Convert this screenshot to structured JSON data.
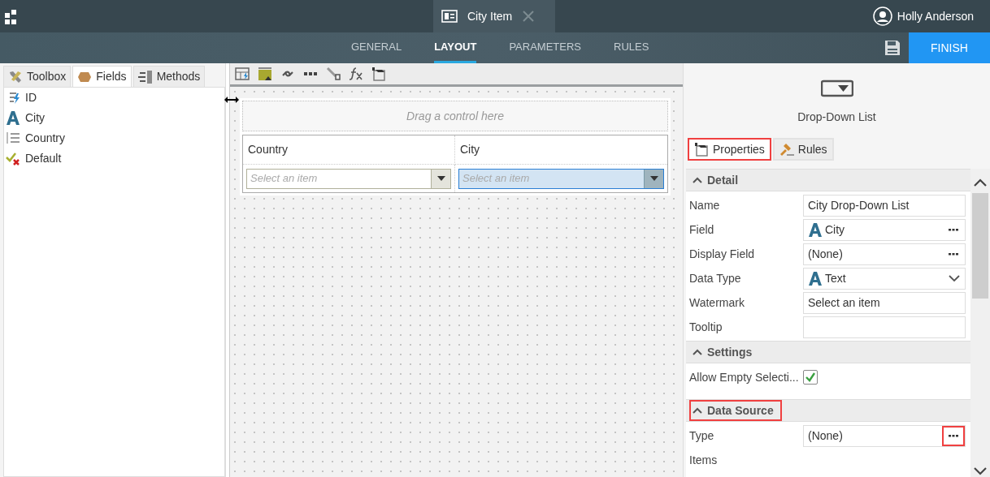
{
  "app_bar": {
    "document_tab": {
      "title": "City Item"
    },
    "user": {
      "name": "Holly Anderson"
    }
  },
  "nav_tabs": [
    {
      "label": "GENERAL",
      "selected": false
    },
    {
      "label": "LAYOUT",
      "selected": true
    },
    {
      "label": "PARAMETERS",
      "selected": false
    },
    {
      "label": "RULES",
      "selected": false
    }
  ],
  "finish_button": "FINISH",
  "left_tabs": [
    {
      "label": "Toolbox",
      "kind": "toolbox",
      "selected": false
    },
    {
      "label": "Fields",
      "kind": "fields",
      "selected": true
    },
    {
      "label": "Methods",
      "kind": "methods",
      "selected": false
    }
  ],
  "fields": [
    {
      "label": "ID",
      "kind": "autonumber"
    },
    {
      "label": "City",
      "kind": "text"
    },
    {
      "label": "Country",
      "kind": "number"
    },
    {
      "label": "Default",
      "kind": "boolean"
    }
  ],
  "canvas": {
    "drop_hint": "Drag a control here",
    "columns": [
      {
        "header": "Country",
        "placeholder": "Select an item",
        "selected": false
      },
      {
        "header": "City",
        "placeholder": "Select an item",
        "selected": true
      }
    ]
  },
  "control": {
    "title": "Drop-Down List"
  },
  "property_tabs": [
    {
      "label": "Properties",
      "kind": "properties",
      "selected": true,
      "highlighted": true
    },
    {
      "label": "Rules",
      "kind": "rules",
      "selected": false,
      "highlighted": false
    }
  ],
  "sections": [
    {
      "title": "Detail",
      "expanded": true,
      "highlighted": false,
      "rows": [
        {
          "label": "Name",
          "kind": "text",
          "value": "City Drop-Down List"
        },
        {
          "label": "Field",
          "kind": "field-picker",
          "value": "City"
        },
        {
          "label": "Display Field",
          "kind": "picker",
          "value": "(None)"
        },
        {
          "label": "Data Type",
          "kind": "type-select",
          "value": "Text"
        },
        {
          "label": "Watermark",
          "kind": "text",
          "value": "Select an item"
        },
        {
          "label": "Tooltip",
          "kind": "text"
        }
      ]
    },
    {
      "title": "Settings",
      "expanded": true,
      "highlighted": false,
      "rows": [
        {
          "label": "Allow Empty Selecti...",
          "kind": "checkbox",
          "checked": true
        }
      ]
    },
    {
      "title": "Data Source",
      "expanded": true,
      "highlighted": true,
      "rows": [
        {
          "label": "Type",
          "kind": "picker",
          "value": "(None)",
          "button_highlighted": true
        },
        {
          "label": "Items",
          "kind": "label"
        }
      ]
    }
  ]
}
